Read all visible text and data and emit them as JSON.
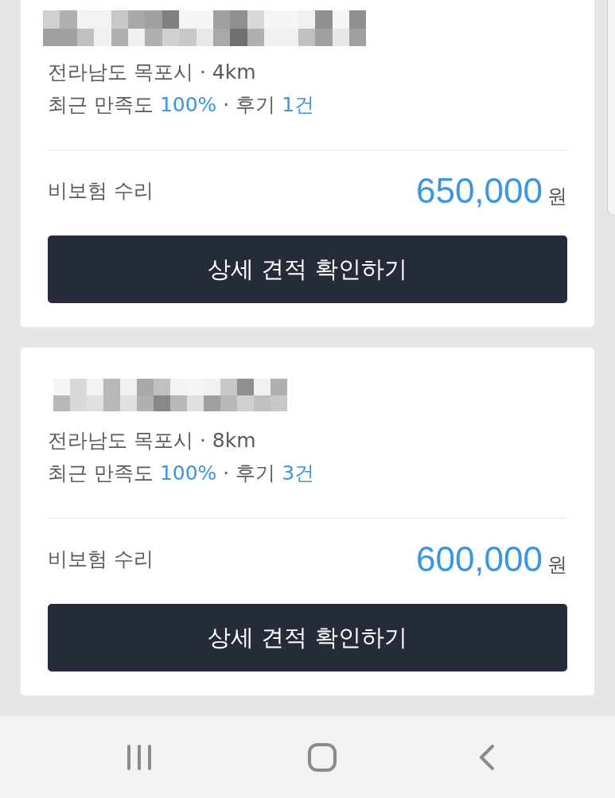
{
  "quotes": [
    {
      "location_line": "전라남도 목포시 · 4km",
      "satisfaction_label": "최근 만족도",
      "satisfaction": "100%",
      "reviews_label": "· 후기",
      "reviews": "1건",
      "repair_type": "비보험 수리",
      "price": "650,000",
      "currency": "원",
      "button": "상세 견적 확인하기"
    },
    {
      "location_line": "전라남도 목포시 · 8km",
      "satisfaction_label": "최근 만족도",
      "satisfaction": "100%",
      "reviews_label": "· 후기",
      "reviews": "3건",
      "repair_type": "비보험 수리",
      "price": "600,000",
      "currency": "원",
      "button": "상세 견적 확인하기"
    }
  ]
}
